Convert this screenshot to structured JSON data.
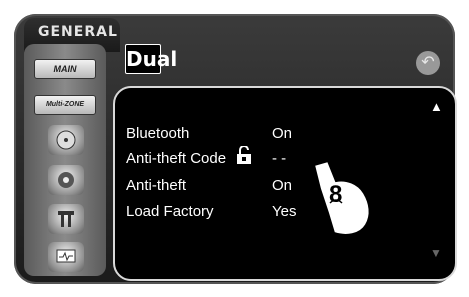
{
  "header": {
    "section_tab": "GENERAL",
    "brand_logo": "Dual"
  },
  "sidebar": {
    "main_button": "MAIN",
    "multizone_button": "Multi-ZONE",
    "icons": [
      "dvd-disc-icon",
      "music-speaker-icon",
      "settings-tools-icon",
      "monitor-icon"
    ]
  },
  "settings": [
    {
      "label": "Bluetooth",
      "value": "On"
    },
    {
      "label": "Anti-theft  Code",
      "value": "- -"
    },
    {
      "label": "Anti-theft",
      "value": "On"
    },
    {
      "label": "Load Factory",
      "value": "Yes"
    }
  ],
  "callout_number": "8"
}
